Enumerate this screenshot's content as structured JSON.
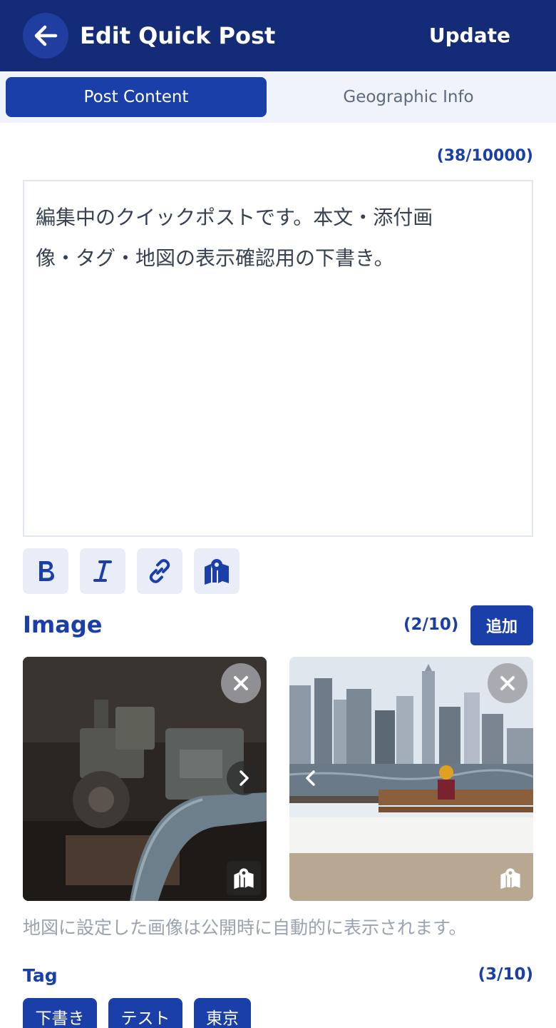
{
  "header": {
    "title": "Edit Quick Post",
    "update_label": "Update",
    "back_icon": "arrow-left-icon",
    "background": "#142c78"
  },
  "tabs": [
    {
      "label": "Post Content",
      "active": true
    },
    {
      "label": "Geographic Info",
      "active": false
    }
  ],
  "editor": {
    "char_count": "(38/10000)",
    "line1": "編集中のクイックポストです。本文・添付画",
    "line2": "像・タグ・地図の表示確認用の下書き。",
    "toolbar": [
      "bold-icon",
      "italic-icon",
      "link-icon",
      "map-icon"
    ]
  },
  "images": {
    "title": "Image",
    "count": "(2/10)",
    "add_label": "追加",
    "items": [
      {
        "description_icon": "machinery-photo",
        "has_next_arrow": true
      },
      {
        "description_icon": "city-skyline-photo",
        "has_prev_arrow": true
      }
    ],
    "note": "地図に設定した画像は公開時に自動的に表示されます。"
  },
  "tags": {
    "title": "Tag",
    "count": "(3/10)",
    "items": [
      "下書き",
      "テスト",
      "東京"
    ]
  },
  "colors": {
    "accent": "#1b3fa8",
    "tab_bg": "#f0f3f9",
    "muted": "#9aa3af"
  }
}
